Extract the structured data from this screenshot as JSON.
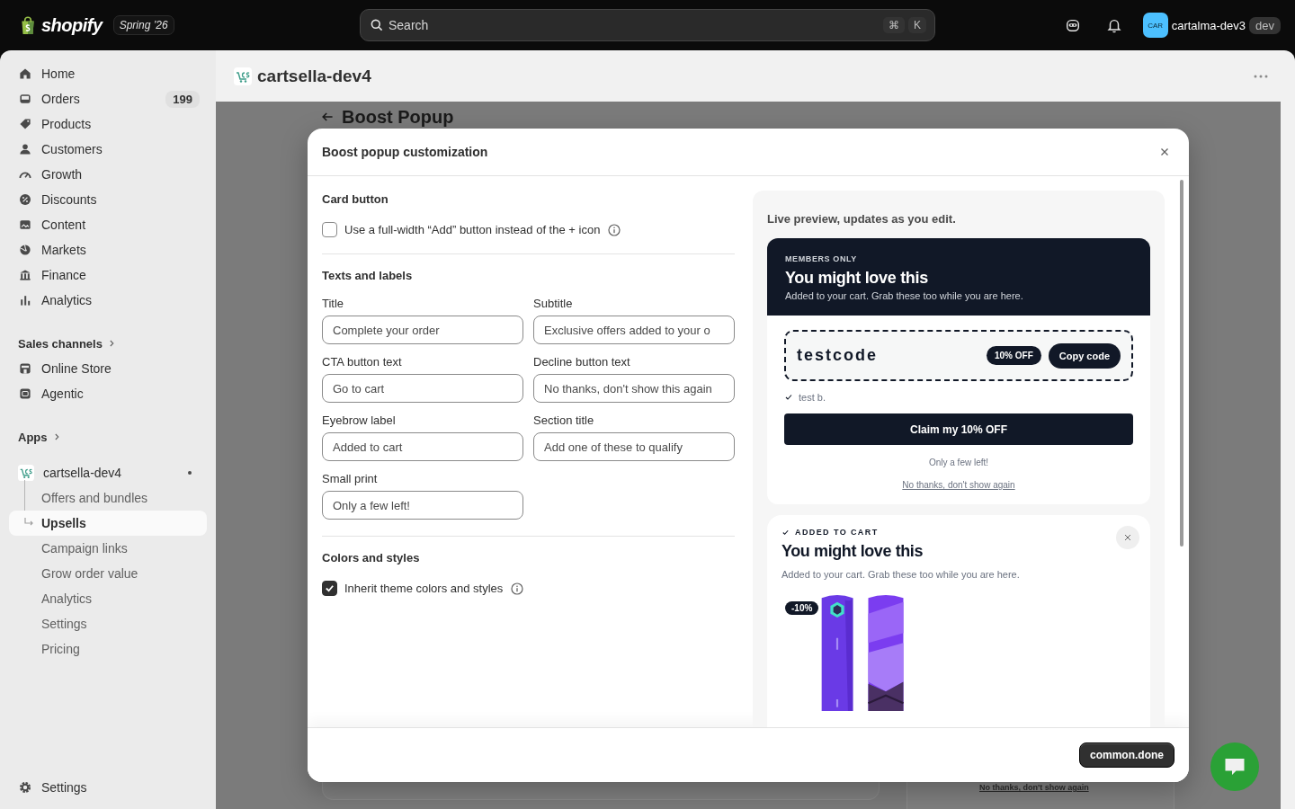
{
  "topbar": {
    "logo": "shopify",
    "release_badge": "Spring ’26",
    "search": {
      "placeholder": "Search",
      "shortcut_keys": [
        "⌘",
        "K"
      ]
    },
    "avatar": "CAR",
    "store_name": "cartalma-dev3",
    "env_badge": "dev"
  },
  "sidebar": {
    "items": [
      {
        "label": "Home",
        "selected": false
      },
      {
        "label": "Orders",
        "badge": "199",
        "selected": false
      },
      {
        "label": "Products",
        "selected": false
      },
      {
        "label": "Customers",
        "selected": false
      },
      {
        "label": "Growth",
        "selected": false
      },
      {
        "label": "Discounts",
        "selected": false
      },
      {
        "label": "Content",
        "selected": false
      },
      {
        "label": "Markets",
        "selected": false
      },
      {
        "label": "Finance",
        "selected": false
      },
      {
        "label": "Analytics",
        "selected": false
      }
    ],
    "sales_channels": {
      "heading": "Sales channels",
      "items": [
        {
          "label": "Online Store",
          "selected": false
        },
        {
          "label": "Agentic",
          "selected": false
        }
      ]
    },
    "apps": {
      "heading": "Apps",
      "items": [
        {
          "label": "cartsella-dev4",
          "selected": false,
          "children": [
            {
              "label": "Offers and bundles",
              "selected": false
            },
            {
              "label": "Upsells",
              "selected": true
            },
            {
              "label": "Campaign links",
              "selected": false
            },
            {
              "label": "Grow order value",
              "selected": false
            },
            {
              "label": "Analytics",
              "selected": false
            },
            {
              "label": "Settings",
              "selected": false
            },
            {
              "label": "Pricing",
              "selected": false
            }
          ]
        }
      ]
    },
    "footer_item": {
      "label": "Settings",
      "selected": false
    }
  },
  "page": {
    "app_title": "cartsella-dev4",
    "background_heading": "Boost Popup",
    "background_link": "No thanks, don't show again"
  },
  "modal": {
    "title": "Boost popup customization",
    "card_button": {
      "heading": "Card button",
      "option": {
        "label": "Use a full-width “Add” button instead of the + icon",
        "checked": false
      }
    },
    "texts": {
      "heading": "Texts and labels",
      "fields": [
        {
          "label": "Title",
          "value": "Complete your order"
        },
        {
          "label": "Subtitle",
          "value": "Exclusive offers added to your o"
        },
        {
          "label": "CTA button text",
          "value": "Go to cart"
        },
        {
          "label": "Decline button text",
          "value": "No thanks, don't show this again"
        },
        {
          "label": "Eyebrow label",
          "value": "Added to cart"
        },
        {
          "label": "Section title",
          "value": "Add one of these to qualify"
        },
        {
          "label": "Small print",
          "value": "Only a few left!"
        }
      ]
    },
    "colors": {
      "heading": "Colors and styles",
      "option": {
        "label": "Inherit theme colors and styles",
        "checked": true
      }
    },
    "preview": {
      "caption": "Live preview, updates as you edit.",
      "popup": {
        "eyebrow": "MEMBERS ONLY",
        "title": "You might love this",
        "subtitle": "Added to your cart. Grab these too while you are here.",
        "code": "testcode",
        "discount_badge": "10% OFF",
        "copy_button": "Copy code",
        "note": "test b.",
        "cta": "Claim my 10% OFF",
        "small_print": "Only a few left!",
        "decline": "No thanks, don't show again"
      },
      "cart_popup": {
        "eyebrow": "ADDED TO CART",
        "title": "You might love this",
        "subtitle": "Added to your cart. Grab these too while you are here.",
        "products": [
          {
            "kind": "picture",
            "discount_badge": "-10%"
          },
          {
            "kind": "picture"
          }
        ]
      }
    },
    "done_button": "common.done"
  }
}
